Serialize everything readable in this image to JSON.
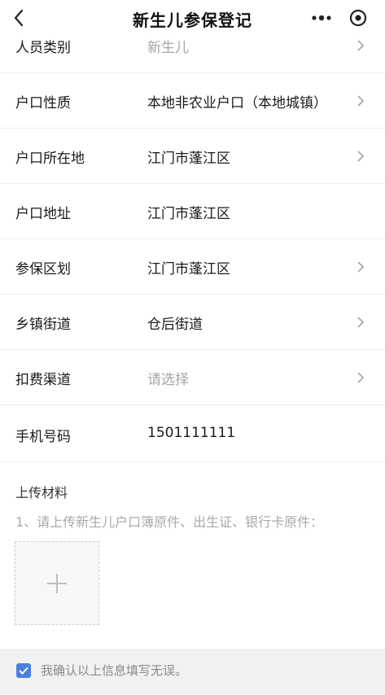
{
  "navbar": {
    "title": "新生儿参保登记",
    "back_icon": "chevron-left-icon",
    "more_icon": "more-dots-icon",
    "close_icon": "target-circle-icon"
  },
  "form": {
    "rows": [
      {
        "label": "人员类别",
        "value": "新生儿",
        "placeholder": false,
        "chevron": true
      },
      {
        "label": "户口性质",
        "value": "本地非农业户口（本地城镇）",
        "placeholder": false,
        "chevron": true
      },
      {
        "label": "户口所在地",
        "value": "江门市蓬江区",
        "placeholder": false,
        "chevron": true
      },
      {
        "label": "户口地址",
        "value": "江门市蓬江区",
        "placeholder": false,
        "chevron": false
      },
      {
        "label": "参保区划",
        "value": "江门市蓬江区",
        "placeholder": false,
        "chevron": true
      },
      {
        "label": "乡镇街道",
        "value": "仓后街道",
        "placeholder": false,
        "chevron": true
      },
      {
        "label": "扣费渠道",
        "value": "请选择",
        "placeholder": true,
        "chevron": true
      },
      {
        "label": "手机号码",
        "value": "1501111111",
        "placeholder": false,
        "chevron": false
      }
    ]
  },
  "upload": {
    "title": "上传材料",
    "hint": "1、请上传新生儿户口簿原件、出生证、银行卡原件：",
    "add_icon": "plus-icon"
  },
  "confirm": {
    "checked": true,
    "text": "我确认以上信息填写无误。"
  },
  "colors": {
    "accent": "#4a7fe0",
    "placeholder_text": "#a6a6a6",
    "divider": "#ededed"
  }
}
